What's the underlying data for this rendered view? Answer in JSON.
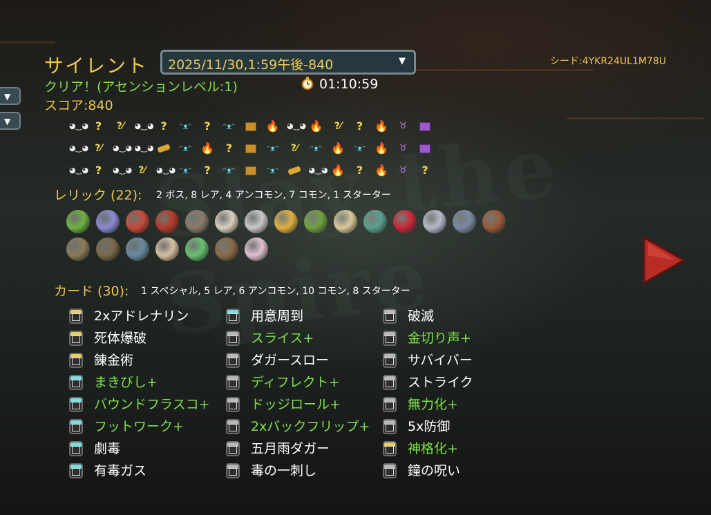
{
  "header": {
    "character": "サイレント",
    "run_select_value": "2025/11/30,1:59午後-840",
    "seed": "シード:4YKR24UL1M78U",
    "result": "クリア！(アセンションレベル:1)",
    "time": "01:10:59",
    "score": "スコア:840"
  },
  "map": {
    "rows": [
      [
        "monster",
        "unknown",
        "unkmon",
        "monster",
        "unknown",
        "elite",
        "unknown",
        "elite",
        "chest",
        "rest",
        "monster",
        "rest",
        "unkmon",
        "unknown",
        "rest",
        "boss",
        "boss-chest"
      ],
      [
        "monster",
        "unkmon",
        "monster",
        "monster",
        "shop",
        "elite",
        "rest",
        "unknown",
        "chest",
        "elite",
        "unkmon",
        "elite",
        "rest",
        "elite",
        "rest",
        "boss",
        "boss-chest"
      ],
      [
        "monster",
        "unknown",
        "monster",
        "unkmon",
        "monster",
        "elite",
        "unknown",
        "elite",
        "chest",
        "elite",
        "shop",
        "monster",
        "rest",
        "unknown",
        "rest",
        "boss",
        "unknown"
      ]
    ],
    "glyphs": {
      "monster": "◕‿◕",
      "unknown": "?",
      "unkmon": "?⁄",
      "elite": "ᵔᴥᵔ",
      "rest": "🔥",
      "boss": "♉"
    }
  },
  "relics": {
    "label": "レリック (22):",
    "summary": "2 ボス, 8 レア, 4 アンコモン, 7 コモン, 1 スターター",
    "row1_colors": [
      "#6fb043",
      "#8a8ad0",
      "#c84a3a",
      "#b43a2a",
      "#8a7a6a",
      "#d9d0c0",
      "#c8c8c8",
      "#e0b040",
      "#6fa040",
      "#d8c89a",
      "#5aa090",
      "#c8283a",
      "#b8b8c8",
      "#7a8aa0",
      "#9a5a3a"
    ],
    "row2_colors": [
      "#8a7a5a",
      "#7a6a4a",
      "#6a8aa0",
      "#d8c0a0",
      "#68c070",
      "#8a6a4a",
      "#e0c0d0"
    ]
  },
  "cards": {
    "label": "カード (30):",
    "summary": "1 スペシャル, 5 レア, 6 アンコモン, 10 コモン, 8 スターター",
    "columns": [
      [
        {
          "name": "2xアドレナリン",
          "upgraded": false,
          "band": "#e5cf6a"
        },
        {
          "name": "死体爆破",
          "upgraded": false,
          "band": "#e5cf6a"
        },
        {
          "name": "錬金術",
          "upgraded": false,
          "band": "#e5cf6a"
        },
        {
          "name": "まきびし+",
          "upgraded": true,
          "band": "#7adfe0"
        },
        {
          "name": "バウンドフラスコ+",
          "upgraded": true,
          "band": "#7adfe0"
        },
        {
          "name": "フットワーク+",
          "upgraded": true,
          "band": "#7adfe0"
        },
        {
          "name": "劇毒",
          "upgraded": false,
          "band": "#7adfe0"
        },
        {
          "name": "有毒ガス",
          "upgraded": false,
          "band": "#7adfe0"
        }
      ],
      [
        {
          "name": "用意周到",
          "upgraded": false,
          "band": "#7adfe0"
        },
        {
          "name": "スライス+",
          "upgraded": true,
          "band": "#b8b8b8"
        },
        {
          "name": "ダガースロー",
          "upgraded": false,
          "band": "#b8b8b8"
        },
        {
          "name": "ディフレクト+",
          "upgraded": true,
          "band": "#b8b8b8"
        },
        {
          "name": "ドッジロール+",
          "upgraded": true,
          "band": "#b8b8b8"
        },
        {
          "name": "2xバックフリップ+",
          "upgraded": true,
          "band": "#b8b8b8"
        },
        {
          "name": "五月雨ダガー",
          "upgraded": false,
          "band": "#b8b8b8"
        },
        {
          "name": "毒の一刺し",
          "upgraded": false,
          "band": "#b8b8b8"
        }
      ],
      [
        {
          "name": "破滅",
          "upgraded": false,
          "band": "#b8b8b8"
        },
        {
          "name": "金切り声+",
          "upgraded": true,
          "band": "#b8b8b8"
        },
        {
          "name": "サバイバー",
          "upgraded": false,
          "band": "#b8b8b8"
        },
        {
          "name": "ストライク",
          "upgraded": false,
          "band": "#b8b8b8"
        },
        {
          "name": "無力化+",
          "upgraded": true,
          "band": "#b8b8b8"
        },
        {
          "name": "5x防御",
          "upgraded": false,
          "band": "#b8b8b8"
        },
        {
          "name": "神格化+",
          "upgraded": true,
          "band": "#e5cf6a"
        },
        {
          "name": "鐘の呪い",
          "upgraded": false,
          "band": "#b8b8b8"
        }
      ]
    ]
  },
  "colors": {
    "gold": "#efc851",
    "upgraded": "#7fe04a",
    "next_arrow": "#c0322a"
  }
}
